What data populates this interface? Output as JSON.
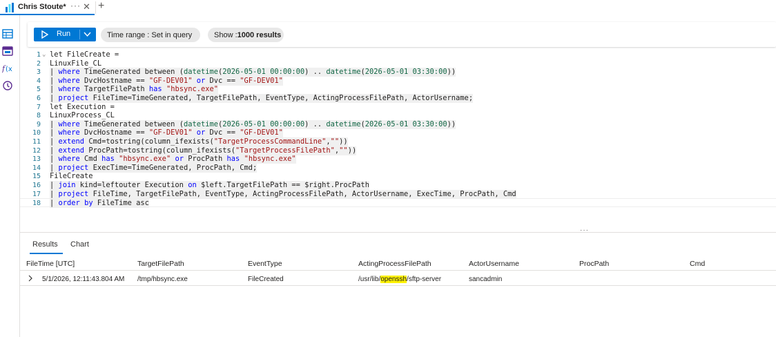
{
  "tab": {
    "title": "Chris Stoute*",
    "more": "···",
    "close": "✕",
    "add": "+"
  },
  "rail": {
    "icons": [
      "table-icon",
      "function-icon",
      "formula-icon",
      "history-icon"
    ]
  },
  "toolbar": {
    "run_label": "Run",
    "time_range_label": "Time range : ",
    "time_range_value": "Set in query",
    "show_label": "Show : ",
    "show_value": "1000 results"
  },
  "colors": {
    "accent": "#0078d4",
    "keyword": "#0000ff",
    "string": "#a31515",
    "function": "#116644",
    "highlight": "#fff200"
  },
  "editor": {
    "lines": [
      [
        [
          "p",
          "let FileCreate ="
        ]
      ],
      [
        [
          "p",
          "LinuxFile_CL"
        ]
      ],
      [
        [
          "p",
          "| "
        ],
        [
          "k",
          "where"
        ],
        [
          "p",
          " TimeGenerated "
        ],
        [
          "p",
          "between"
        ],
        [
          "p",
          " ("
        ],
        [
          "f",
          "datetime"
        ],
        [
          "p",
          "("
        ],
        [
          "f",
          "2026-05-01 00:00:00"
        ],
        [
          "p",
          ") .. "
        ],
        [
          "f",
          "datetime"
        ],
        [
          "p",
          "("
        ],
        [
          "f",
          "2026-05-01 03:30:00"
        ],
        [
          "p",
          "))"
        ]
      ],
      [
        [
          "p",
          "| "
        ],
        [
          "k",
          "where"
        ],
        [
          "p",
          " DvcHostname == "
        ],
        [
          "s",
          "\"GF-DEV01\""
        ],
        [
          "p",
          " "
        ],
        [
          "k",
          "or"
        ],
        [
          "p",
          " Dvc == "
        ],
        [
          "s",
          "\"GF-DEV01\""
        ]
      ],
      [
        [
          "p",
          "| "
        ],
        [
          "k",
          "where"
        ],
        [
          "p",
          " TargetFilePath "
        ],
        [
          "k",
          "has"
        ],
        [
          "p",
          " "
        ],
        [
          "s",
          "\"hbsync.exe\""
        ]
      ],
      [
        [
          "p",
          "| "
        ],
        [
          "k",
          "project"
        ],
        [
          "p",
          " FileTime=TimeGenerated, TargetFilePath, EventType, ActingProcessFilePath, ActorUsername;"
        ]
      ],
      [
        [
          "p",
          "let Execution ="
        ]
      ],
      [
        [
          "p",
          "LinuxProcess_CL"
        ]
      ],
      [
        [
          "p",
          "| "
        ],
        [
          "k",
          "where"
        ],
        [
          "p",
          " TimeGenerated "
        ],
        [
          "p",
          "between"
        ],
        [
          "p",
          " ("
        ],
        [
          "f",
          "datetime"
        ],
        [
          "p",
          "("
        ],
        [
          "f",
          "2026-05-01 00:00:00"
        ],
        [
          "p",
          ") .. "
        ],
        [
          "f",
          "datetime"
        ],
        [
          "p",
          "("
        ],
        [
          "f",
          "2026-05-01 03:30:00"
        ],
        [
          "p",
          "))"
        ]
      ],
      [
        [
          "p",
          "| "
        ],
        [
          "k",
          "where"
        ],
        [
          "p",
          " DvcHostname == "
        ],
        [
          "s",
          "\"GF-DEV01\""
        ],
        [
          "p",
          " "
        ],
        [
          "k",
          "or"
        ],
        [
          "p",
          " Dvc == "
        ],
        [
          "s",
          "\"GF-DEV01\""
        ]
      ],
      [
        [
          "p",
          "| "
        ],
        [
          "k",
          "extend"
        ],
        [
          "p",
          " Cmd=tostring(column_ifexists("
        ],
        [
          "s",
          "\"TargetProcessCommandLine\""
        ],
        [
          "p",
          ","
        ],
        [
          "s",
          "\"\""
        ],
        [
          "p",
          "))"
        ]
      ],
      [
        [
          "p",
          "| "
        ],
        [
          "k",
          "extend"
        ],
        [
          "p",
          " ProcPath=tostring(column_ifexists("
        ],
        [
          "s",
          "\"TargetProcessFilePath\""
        ],
        [
          "p",
          ","
        ],
        [
          "s",
          "\"\""
        ],
        [
          "p",
          "))"
        ]
      ],
      [
        [
          "p",
          "| "
        ],
        [
          "k",
          "where"
        ],
        [
          "p",
          " Cmd "
        ],
        [
          "k",
          "has"
        ],
        [
          "p",
          " "
        ],
        [
          "s",
          "\"hbsync.exe\""
        ],
        [
          "p",
          " "
        ],
        [
          "k",
          "or"
        ],
        [
          "p",
          " ProcPath "
        ],
        [
          "k",
          "has"
        ],
        [
          "p",
          " "
        ],
        [
          "s",
          "\"hbsync.exe\""
        ]
      ],
      [
        [
          "p",
          "| "
        ],
        [
          "k",
          "project"
        ],
        [
          "p",
          " ExecTime=TimeGenerated, ProcPath, Cmd;"
        ]
      ],
      [
        [
          "p",
          "FileCreate"
        ]
      ],
      [
        [
          "p",
          "| "
        ],
        [
          "k",
          "join"
        ],
        [
          "p",
          " kind=leftouter Execution "
        ],
        [
          "k",
          "on"
        ],
        [
          "p",
          " $left.TargetFilePath == $right.ProcPath"
        ]
      ],
      [
        [
          "p",
          "| "
        ],
        [
          "k",
          "project"
        ],
        [
          "p",
          " FileTime, TargetFilePath, EventType, ActingProcessFilePath, ActorUsername, ExecTime, ProcPath, Cmd"
        ]
      ],
      [
        [
          "p",
          "| "
        ],
        [
          "k",
          "order"
        ],
        [
          "p",
          " "
        ],
        [
          "k",
          "by"
        ],
        [
          "p",
          " FileTime asc"
        ]
      ]
    ]
  },
  "splitter_dots": "···",
  "results": {
    "tabs": [
      "Results",
      "Chart"
    ],
    "columns": [
      "FileTime [UTC]",
      "TargetFilePath",
      "EventType",
      "ActingProcessFilePath",
      "ActorUsername",
      "ProcPath",
      "Cmd"
    ],
    "rows": [
      {
        "file_time": "5/1/2026, 12:11:43.804 AM",
        "target_file_path": "/tmp/hbsync.exe",
        "event_type": "FileCreated",
        "acting_process_prefix": "/usr/lib/",
        "acting_process_mark": "openssh",
        "acting_process_suffix": "/sftp-server",
        "actor_username": "sancadmin",
        "proc_path": "",
        "cmd": ""
      }
    ]
  }
}
